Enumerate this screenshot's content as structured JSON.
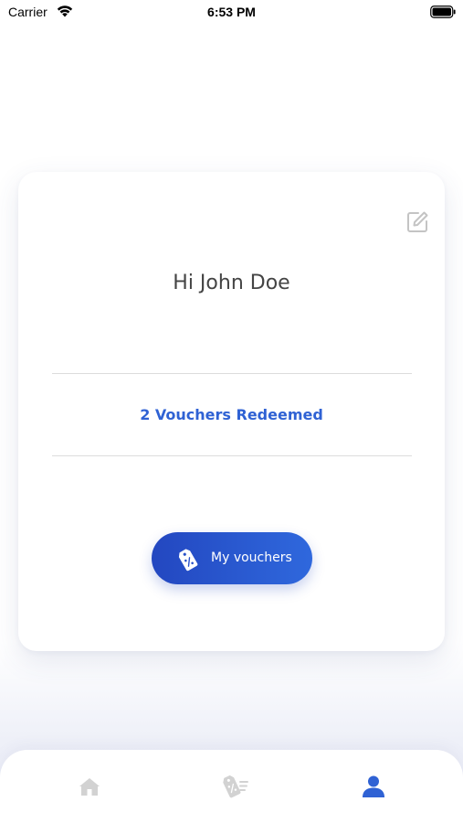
{
  "status_bar": {
    "carrier": "Carrier",
    "time": "6:53 PM",
    "icons": [
      "wifi-icon",
      "battery-icon"
    ]
  },
  "profile": {
    "greeting": "Hi John Doe",
    "vouchers_redeemed": "2 Vouchers Redeemed",
    "edit_icon": "edit-icon",
    "my_vouchers_button": {
      "label": "My vouchers",
      "icon": "voucher-tag-icon"
    }
  },
  "tab_bar": {
    "tabs": [
      {
        "icon": "home-icon",
        "active": false
      },
      {
        "icon": "vouchers-icon",
        "active": false
      },
      {
        "icon": "profile-icon",
        "active": true
      }
    ]
  },
  "colors": {
    "accent": "#2f62d4",
    "button_gradient_start": "#2347c0",
    "button_gradient_end": "#2f68dd",
    "inactive_icon": "#cfcfcf",
    "greeting_text": "#444444"
  }
}
